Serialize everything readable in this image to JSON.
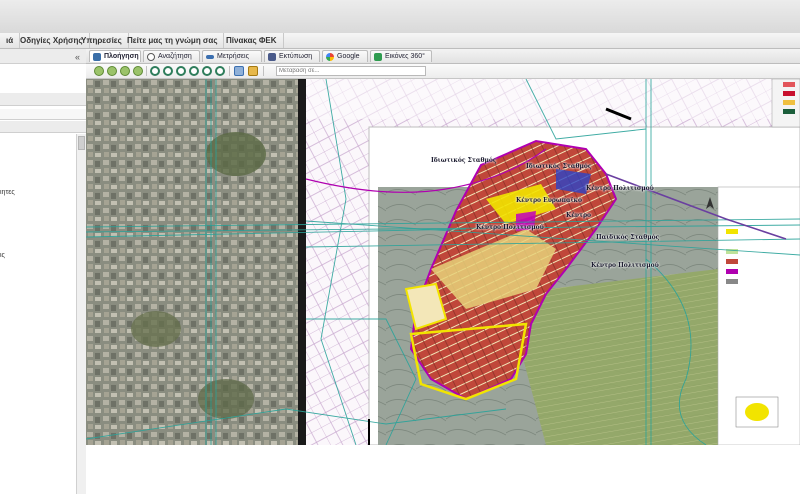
{
  "menubar": {
    "items": [
      "ιά",
      "Οδηγίες Χρήσης",
      "Υπηρεσίες",
      "Πείτε μας τη γνώμη σας",
      "Πίνακας ΦΕΚ"
    ]
  },
  "tabs": [
    {
      "label": "Πλοήγηση",
      "icon": "hand-pan-icon",
      "color": "#3a6ea8",
      "active": true
    },
    {
      "label": "Αναζήτηση",
      "icon": "magnifier-icon",
      "color": "#555555",
      "active": false
    },
    {
      "label": "Μετρήσεις",
      "icon": "ruler-icon",
      "color": "#3b6fb0",
      "active": false
    },
    {
      "label": "Εκτύπωση",
      "icon": "printer-icon",
      "color": "#4a5a8a",
      "active": false
    },
    {
      "label": "Google",
      "icon": "google-g-icon",
      "color": "#dd4b39",
      "active": false
    },
    {
      "label": "Εικόνες 360°",
      "icon": "camera-360-icon",
      "color": "#2e9b4f",
      "active": false
    }
  ],
  "collapse_label": "«",
  "search": {
    "placeholder": "Μετάβαση σε..."
  },
  "left_panel": {
    "fragments": [
      "ιητες",
      "ις"
    ]
  },
  "map_labels": [
    "Ιδιωτικός Σταθμός",
    "Ιδιωτικός Σταθμός",
    "Κέντρο Πολιτισμού",
    "Κέντρο Ευρωπαϊκό",
    "Κέντρο",
    "Παιδικός Σταθμός",
    "Κέντρο Πολιτισμού",
    "Κέντρο Πολιτισμού"
  ],
  "colors": {
    "accent": "#3a6ea8",
    "overlay_lines": "#2aa39a",
    "parcel_red": "#c0473a",
    "boundary_yellow": "#f2e400",
    "boundary_magenta": "#b000b0"
  }
}
